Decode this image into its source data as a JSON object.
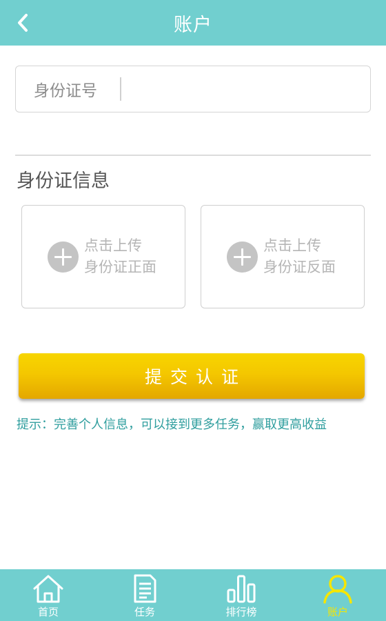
{
  "header": {
    "title": "账户",
    "back_icon": "chevron-left-icon"
  },
  "id_field": {
    "label": "身份证号",
    "value": "",
    "placeholder": ""
  },
  "id_info": {
    "title": "身份证信息",
    "front": {
      "line1": "点击上传",
      "line2": "身份证正面",
      "icon": "plus-circle-icon"
    },
    "back": {
      "line1": "点击上传",
      "line2": "身份证反面",
      "icon": "plus-circle-icon"
    }
  },
  "submit_label": "提交认证",
  "hint": "提示：完善个人信息，可以接到更多任务，赢取更高收益",
  "tabbar": {
    "items": [
      {
        "label": "首页",
        "icon": "home-icon",
        "active": false
      },
      {
        "label": "任务",
        "icon": "document-icon",
        "active": false
      },
      {
        "label": "排行榜",
        "icon": "bar-chart-icon",
        "active": false
      },
      {
        "label": "账户",
        "icon": "user-icon",
        "active": true
      }
    ]
  },
  "colors": {
    "header_bg": "#71cfcf",
    "accent_yellow": "#f4c700",
    "active_tab": "#f6e600",
    "hint_text": "#2f9e9e"
  }
}
